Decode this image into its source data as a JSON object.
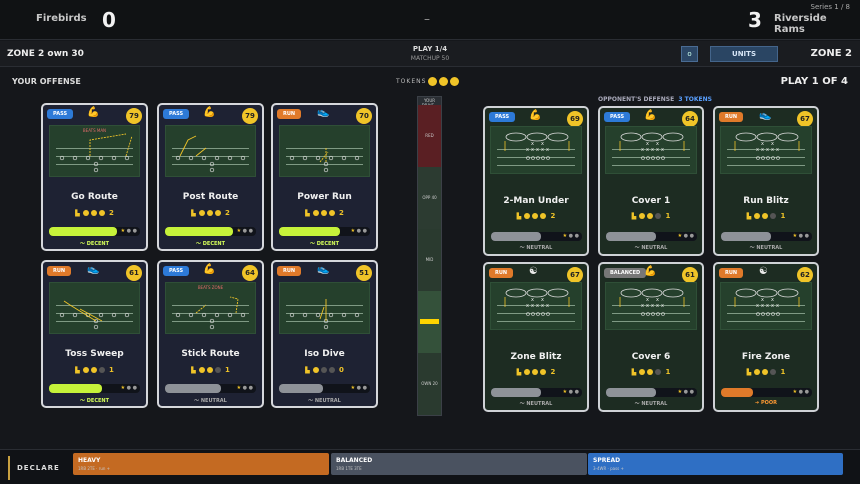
{
  "scoreboard": {
    "home_team": "Firebirds",
    "home_score": "0",
    "separator": "–",
    "away_score": "3",
    "away_team": "Riverside Rams",
    "series": "Series 1 / 8"
  },
  "subheader": {
    "zone_left": "ZONE 2  own 30",
    "play": "PLAY 1/4",
    "matchup": "MATCHUP 50",
    "info_icon": "o",
    "units_label": "UNITS",
    "zone_right": "ZONE 2"
  },
  "labels": {
    "your_offense": "YOUR OFFENSE",
    "tokens": "TOKENS",
    "play_of": "PLAY 1 OF 4",
    "opp_defense": "OPPONENT'S DEFENSE",
    "opp_tokens": "3 TOKENS"
  },
  "meter": {
    "title": "YOUR DRIVE ▸",
    "zones": [
      "RED",
      "OPP 40",
      "MID",
      "OWN 20"
    ]
  },
  "offense": [
    {
      "tag": "PASS",
      "tag_type": "pass",
      "icon": "flexed-arm-icon",
      "rating": "79",
      "field_label": "BEATS MAN",
      "name": "Go Route",
      "stars": "2",
      "grade": "DECENT"
    },
    {
      "tag": "PASS",
      "tag_type": "pass",
      "icon": "flexed-arm-icon",
      "rating": "79",
      "field_label": "",
      "name": "Post Route",
      "stars": "2",
      "grade": "DECENT"
    },
    {
      "tag": "RUN",
      "tag_type": "run",
      "icon": "sneaker-icon",
      "rating": "70",
      "field_label": "",
      "name": "Power Run",
      "stars": "2",
      "grade": "DECENT"
    },
    {
      "tag": "RUN",
      "tag_type": "run",
      "icon": "sneaker-icon",
      "rating": "61",
      "field_label": "",
      "name": "Toss Sweep",
      "stars": "1",
      "grade": "DECENT"
    },
    {
      "tag": "PASS",
      "tag_type": "pass",
      "icon": "flexed-arm-icon",
      "rating": "64",
      "field_label": "BEATS ZONE",
      "name": "Stick Route",
      "stars": "1",
      "grade": "NEUTRAL"
    },
    {
      "tag": "RUN",
      "tag_type": "run",
      "icon": "sneaker-icon",
      "rating": "51",
      "field_label": "",
      "name": "Iso Dive",
      "stars": "0",
      "grade": "NEUTRAL"
    }
  ],
  "defense": [
    {
      "tag": "PASS",
      "tag_type": "pass",
      "icon": "flexed-arm-icon",
      "rating": "69",
      "name": "2-Man Under",
      "stars": "2",
      "grade": "NEUTRAL"
    },
    {
      "tag": "PASS",
      "tag_type": "pass",
      "icon": "flexed-arm-icon",
      "rating": "64",
      "name": "Cover 1",
      "stars": "1",
      "grade": "NEUTRAL"
    },
    {
      "tag": "RUN",
      "tag_type": "run",
      "icon": "sneaker-icon",
      "rating": "67",
      "name": "Run Blitz",
      "stars": "1",
      "grade": "NEUTRAL"
    },
    {
      "tag": "RUN",
      "tag_type": "run",
      "icon": "yin-yang-icon",
      "rating": "67",
      "name": "Zone Blitz",
      "stars": "2",
      "grade": "NEUTRAL"
    },
    {
      "tag": "BALANCED",
      "tag_type": "bal",
      "icon": "flexed-arm-icon",
      "rating": "61",
      "name": "Cover 6",
      "stars": "1",
      "grade": "NEUTRAL"
    },
    {
      "tag": "RUN",
      "tag_type": "run",
      "icon": "yin-yang-icon",
      "rating": "62",
      "name": "Fire Zone",
      "stars": "1",
      "grade": "POOR"
    }
  ],
  "declare": {
    "label": "DECLARE",
    "options": [
      {
        "name": "HEAVY",
        "sub": "1RB 2TE · run +",
        "color": "#c46a22"
      },
      {
        "name": "BALANCED",
        "sub": "1RB 1TE 3TE",
        "color": "#4a5260"
      },
      {
        "name": "SPREAD",
        "sub": "3-4WR · pass +",
        "color": "#2f6fc4"
      }
    ]
  },
  "colors": {
    "gold": "#f0c428",
    "pass": "#2d7ad8",
    "run": "#e07a2a",
    "decent": "#c6f23a",
    "neutral": "#8e9298",
    "poor": "#e07a2a"
  }
}
